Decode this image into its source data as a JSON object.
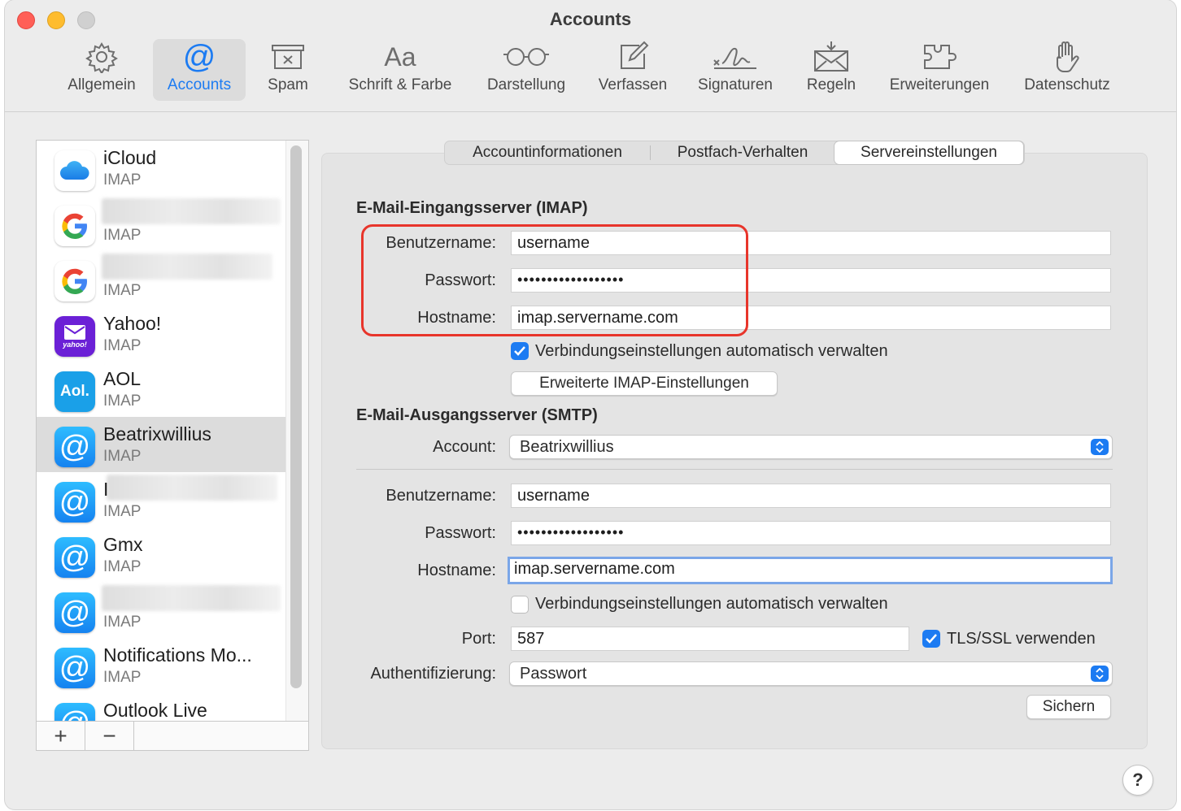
{
  "window": {
    "title": "Accounts"
  },
  "toolbar": {
    "items": [
      {
        "label": "Allgemein",
        "icon": "gear-icon"
      },
      {
        "label": "Accounts",
        "icon": "at-icon",
        "selected": true
      },
      {
        "label": "Spam",
        "icon": "spam-icon"
      },
      {
        "label": "Schrift & Farbe",
        "icon": "font-icon",
        "glyph": "Aa"
      },
      {
        "label": "Darstellung",
        "icon": "glasses-icon"
      },
      {
        "label": "Verfassen",
        "icon": "compose-icon"
      },
      {
        "label": "Signaturen",
        "icon": "signature-icon"
      },
      {
        "label": "Regeln",
        "icon": "rules-icon"
      },
      {
        "label": "Erweiterungen",
        "icon": "extensions-icon"
      },
      {
        "label": "Datenschutz",
        "icon": "hand-icon"
      }
    ]
  },
  "sidebar": {
    "accounts": [
      {
        "name": "iCloud",
        "type": "IMAP",
        "icon": "icloud-icon"
      },
      {
        "name": "",
        "type": "IMAP",
        "icon": "google-icon",
        "blurred": true
      },
      {
        "name": "",
        "type": "IMAP",
        "icon": "google-icon",
        "blurred": true
      },
      {
        "name": "Yahoo!",
        "type": "IMAP",
        "icon": "yahoo-icon",
        "icon_text": "yahoo!"
      },
      {
        "name": "AOL",
        "type": "IMAP",
        "icon": "aol-icon",
        "icon_text": "Aol."
      },
      {
        "name": "Beatrixwillius",
        "type": "IMAP",
        "icon": "at-account-icon",
        "selected": true
      },
      {
        "name": "I",
        "type": "IMAP",
        "icon": "at-account-icon",
        "blurred": true
      },
      {
        "name": "Gmx",
        "type": "IMAP",
        "icon": "at-account-icon"
      },
      {
        "name": "",
        "type": "IMAP",
        "icon": "at-account-icon",
        "blurred": true
      },
      {
        "name": "Notifications Mo...",
        "type": "IMAP",
        "icon": "at-account-icon"
      },
      {
        "name": "Outlook Live",
        "type": "",
        "icon": "at-account-icon"
      }
    ],
    "add_label": "+",
    "remove_label": "−"
  },
  "tabs": [
    {
      "label": "Accountinformationen"
    },
    {
      "label": "Postfach-Verhalten"
    },
    {
      "label": "Servereinstellungen",
      "selected": true
    }
  ],
  "incoming": {
    "heading": "E-Mail-Eingangsserver (IMAP)",
    "username_label": "Benutzername:",
    "username": "username",
    "password_label": "Passwort:",
    "password": "••••••••••••••••••",
    "hostname_label": "Hostname:",
    "hostname": "imap.servername.com",
    "auto_manage_label": "Verbindungseinstellungen automatisch verwalten",
    "auto_manage": true,
    "advanced_button": "Erweiterte IMAP-Einstellungen"
  },
  "outgoing": {
    "heading": "E-Mail-Ausgangsserver (SMTP)",
    "account_label": "Account:",
    "account": "Beatrixwillius",
    "username_label": "Benutzername:",
    "username": "username",
    "password_label": "Passwort:",
    "password": "••••••••••••••••••",
    "hostname_label": "Hostname:",
    "hostname": "imap.servername.com",
    "auto_manage_label": "Verbindungseinstellungen automatisch verwalten",
    "auto_manage": false,
    "port_label": "Port:",
    "port": "587",
    "tls_label": "TLS/SSL verwenden",
    "tls": true,
    "auth_label": "Authentifizierung:",
    "auth": "Passwort",
    "save_button": "Sichern"
  },
  "help": {
    "label": "?"
  },
  "colors": {
    "accent": "#1c7bf2",
    "highlight": "#e8352b"
  }
}
